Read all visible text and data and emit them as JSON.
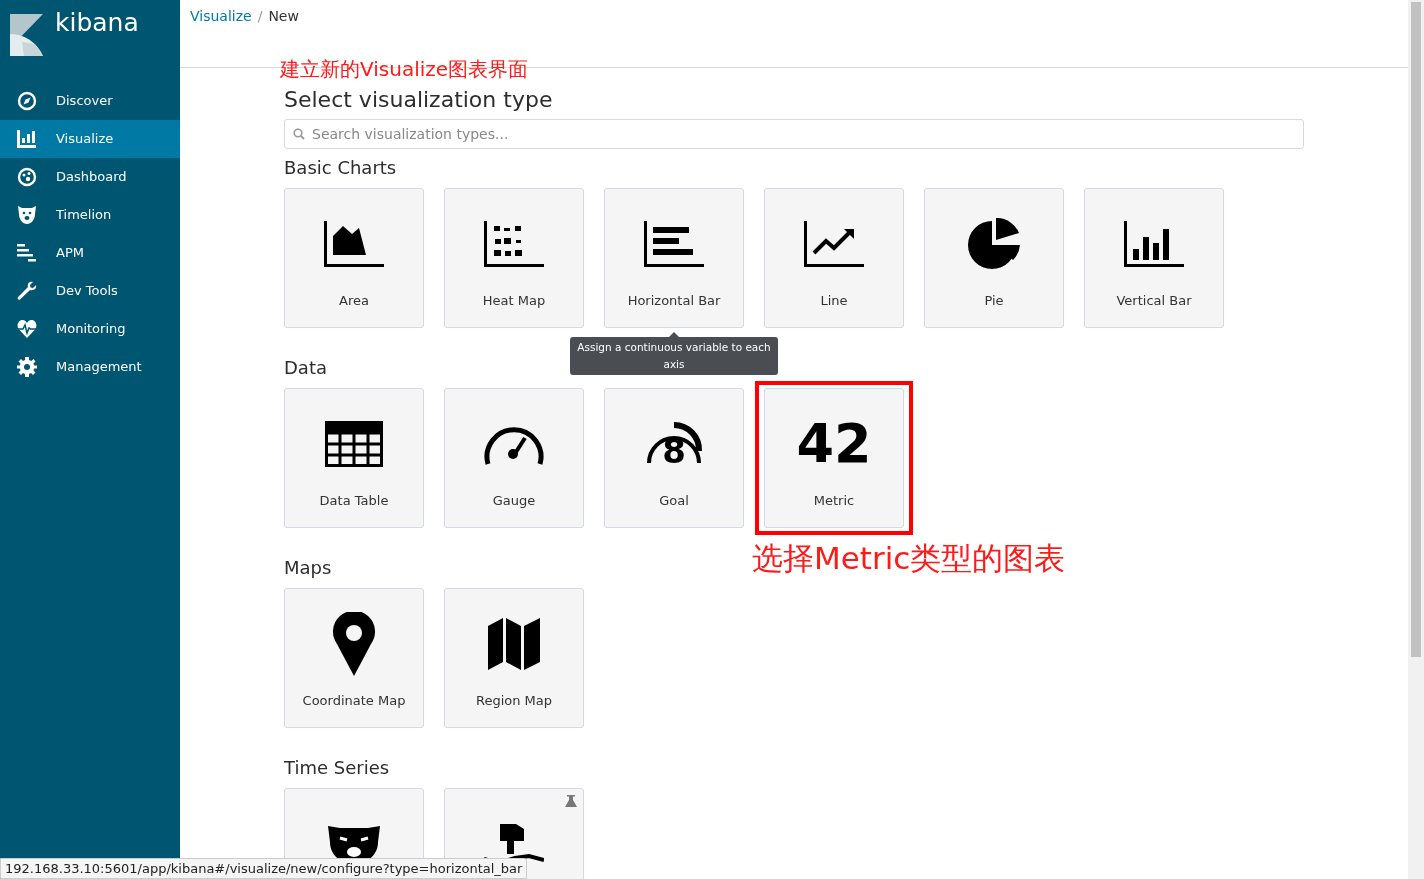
{
  "sidebar": {
    "logo": "kibana",
    "items": [
      {
        "label": "Discover",
        "kind": "compass",
        "selected": false
      },
      {
        "label": "Visualize",
        "kind": "bars",
        "selected": true
      },
      {
        "label": "Dashboard",
        "kind": "dial",
        "selected": false
      },
      {
        "label": "Timelion",
        "kind": "bear",
        "selected": false
      },
      {
        "label": "APM",
        "kind": "lines",
        "selected": false
      },
      {
        "label": "Dev Tools",
        "kind": "wrench",
        "selected": false
      },
      {
        "label": "Monitoring",
        "kind": "heart",
        "selected": false
      },
      {
        "label": "Management",
        "kind": "gear",
        "selected": false
      }
    ]
  },
  "breadcrumbs": [
    "Visualize",
    "New"
  ],
  "breadcrumb_separator": "/",
  "annotations": {
    "page_note": "建立新的Visualize图表界面",
    "metric_note": "选择Metric类型的图表"
  },
  "title": "Select visualization type",
  "search": {
    "placeholder": "Search visualization types..."
  },
  "sections": [
    {
      "title": "Basic Charts",
      "types": [
        {
          "label": "Area",
          "kind": "area",
          "highlighted": false,
          "experimental": false
        },
        {
          "label": "Heat Map",
          "kind": "heatmap",
          "highlighted": false,
          "experimental": false
        },
        {
          "label": "Horizontal Bar",
          "kind": "hbar",
          "highlighted": false,
          "experimental": false,
          "tooltip": "Assign a continuous variable to each axis"
        },
        {
          "label": "Line",
          "kind": "line",
          "highlighted": false,
          "experimental": false
        },
        {
          "label": "Pie",
          "kind": "pie",
          "highlighted": false,
          "experimental": false
        },
        {
          "label": "Vertical Bar",
          "kind": "vbar",
          "highlighted": false,
          "experimental": false
        }
      ]
    },
    {
      "title": "Data",
      "types": [
        {
          "label": "Data Table",
          "kind": "table",
          "highlighted": false,
          "experimental": false
        },
        {
          "label": "Gauge",
          "kind": "gauge",
          "highlighted": false,
          "experimental": false
        },
        {
          "label": "Goal",
          "kind": "goal",
          "highlighted": false,
          "experimental": false,
          "icon_text": "8"
        },
        {
          "label": "Metric",
          "kind": "metric",
          "highlighted": true,
          "experimental": false,
          "icon_text": "42"
        }
      ]
    },
    {
      "title": "Maps",
      "types": [
        {
          "label": "Coordinate Map",
          "kind": "pin",
          "highlighted": false,
          "experimental": false
        },
        {
          "label": "Region Map",
          "kind": "map",
          "highlighted": false,
          "experimental": false
        }
      ]
    },
    {
      "title": "Time Series",
      "types": [
        {
          "kind": "bear",
          "highlighted": false,
          "experimental": false
        },
        {
          "kind": "sign",
          "highlighted": false,
          "experimental": true
        }
      ]
    }
  ],
  "status_bar": {
    "url": "192.168.33.10:5601/app/kibana#/visualize/new/configure?type=horizontal_bar"
  }
}
